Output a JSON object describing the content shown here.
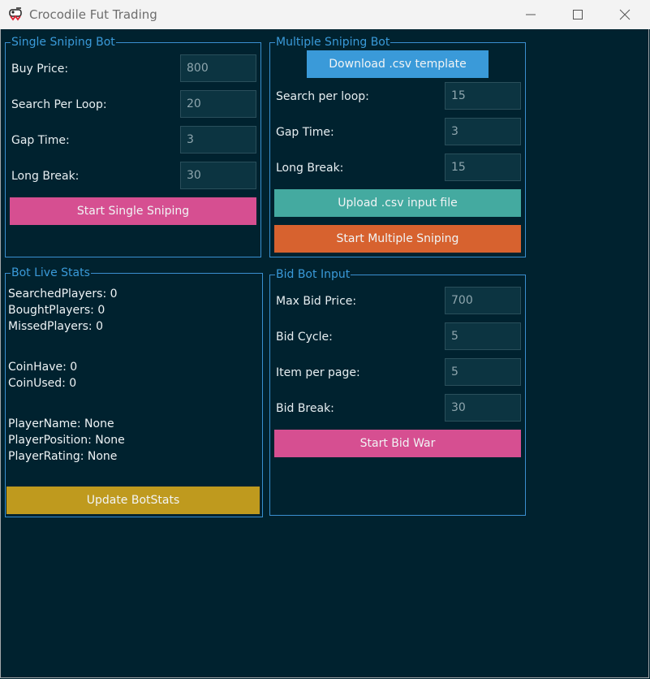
{
  "window": {
    "title": "Crocodile Fut Trading"
  },
  "single": {
    "title": "Single Sniping Bot",
    "buy_price_label": "Buy Price:",
    "buy_price": "800",
    "search_label": "Search Per Loop:",
    "search": "20",
    "gap_label": "Gap Time:",
    "gap": "3",
    "break_label": "Long Break:",
    "break": "30",
    "start_label": "Start Single Sniping"
  },
  "multiple": {
    "title": "Multiple Sniping Bot",
    "download_label": "Download .csv template",
    "search_label": "Search per loop:",
    "search": "15",
    "gap_label": "Gap Time:",
    "gap": "3",
    "break_label": "Long Break:",
    "break": "15",
    "upload_label": "Upload .csv input file",
    "start_label": "Start Multiple Sniping"
  },
  "stats": {
    "title": "Bot Live Stats",
    "searched": "SearchedPlayers: 0",
    "bought": "BoughtPlayers: 0",
    "missed": "MissedPlayers: 0",
    "coin_have": "CoinHave: 0",
    "coin_used": "CoinUsed: 0",
    "player_name": "PlayerName: None",
    "player_position": "PlayerPosition: None",
    "player_rating": "PlayerRating: None",
    "update_label": "Update BotStats"
  },
  "bid": {
    "title": "Bid Bot Input",
    "max_label": "Max Bid Price:",
    "max": "700",
    "cycle_label": "Bid Cycle:",
    "cycle": "5",
    "items_label": "Item per page:",
    "items": "5",
    "break_label": "Bid Break:",
    "break": "30",
    "start_label": "Start Bid War"
  },
  "colors": {
    "background": "#00222f",
    "accent": "#3a9ad9",
    "pink": "#d64f91",
    "blue": "#3a9ad9",
    "teal": "#44aaa0",
    "orange": "#d7622f",
    "gold": "#bf9a1e"
  },
  "icons": [
    "crocodile-app-icon",
    "minimize-icon",
    "maximize-icon",
    "close-icon"
  ]
}
